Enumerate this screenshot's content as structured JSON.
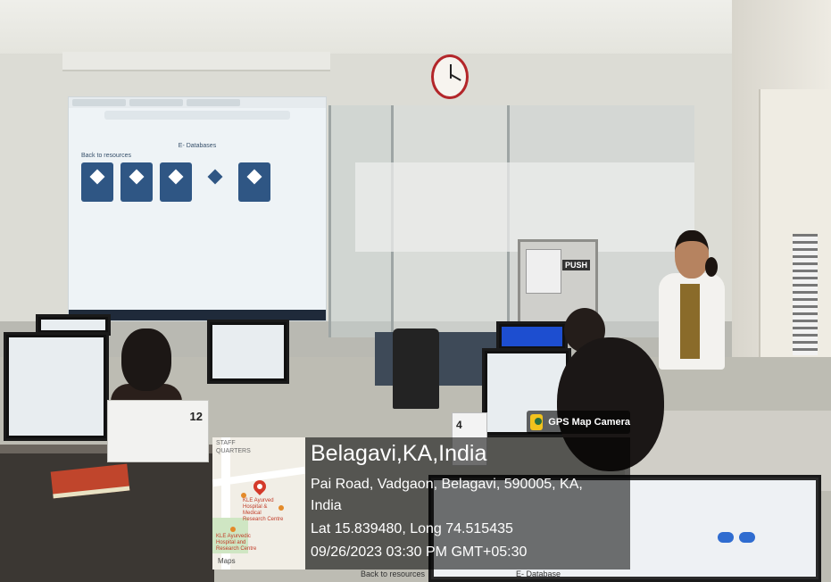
{
  "photo": {
    "description_role": "classroom-photo",
    "pc_numbers": [
      "12",
      "4"
    ],
    "push_sign": "PUSH"
  },
  "projector": {
    "heading": "E- Databases",
    "back_link": "Back to resources"
  },
  "map": {
    "staff_quarters": "STAFF\nQUARTERS",
    "poi_hospital": "KLE Ayurved Hospital & Medical Research Centre",
    "poi_ayurvedic": "KLE Ayurvedic Hospital and Research Centre",
    "brand": "Maps"
  },
  "gps": {
    "badge_label": "GPS Map Camera",
    "city": "Belagavi,KA,India",
    "address_line1": "Pai Road, Vadgaon, Belagavi, 590005, KA,",
    "address_line2": "India",
    "coords": "Lat 15.839480, Long 74.515435",
    "datetime": "09/26/2023 03:30 PM GMT+05:30"
  },
  "bottom_screen": {
    "left_text": "Back to resources",
    "right_text": "E- Database"
  },
  "colors": {
    "tile_blue": "#2f5684",
    "clock_red": "#b3262a",
    "overlay": "rgba(0,0,0,0.55)"
  }
}
